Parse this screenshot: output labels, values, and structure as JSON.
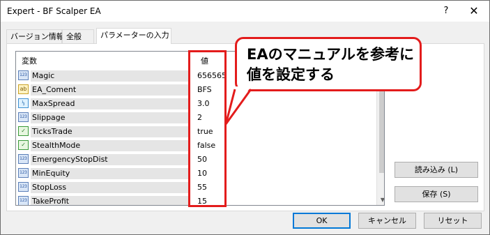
{
  "window": {
    "title": "Expert - BF Scalper EA",
    "help_glyph": "?",
    "close_glyph": "✕"
  },
  "tabs": [
    {
      "label": "バージョン情報"
    },
    {
      "label": "全般"
    },
    {
      "label": "パラメーターの入力",
      "active": true
    }
  ],
  "table": {
    "columns": {
      "variable": "変数",
      "value": "値"
    },
    "rows": [
      {
        "icon": "123",
        "icon_type": "int-icon",
        "name": "Magic",
        "value": "656565"
      },
      {
        "icon": "ab",
        "icon_type": "string-icon",
        "name": "EA_Coment",
        "value": "BFS"
      },
      {
        "icon": "½",
        "icon_type": "double-icon",
        "name": "MaxSpread",
        "value": "3.0"
      },
      {
        "icon": "123",
        "icon_type": "int-icon",
        "name": "Slippage",
        "value": "2"
      },
      {
        "icon": "✓",
        "icon_type": "bool-icon",
        "name": "TicksTrade",
        "value": "true"
      },
      {
        "icon": "✓",
        "icon_type": "bool-icon",
        "name": "StealthMode",
        "value": "false"
      },
      {
        "icon": "123",
        "icon_type": "int-icon",
        "name": "EmergencyStopDist",
        "value": "50"
      },
      {
        "icon": "123",
        "icon_type": "int-icon",
        "name": "MinEquity",
        "value": "10"
      },
      {
        "icon": "123",
        "icon_type": "int-icon",
        "name": "StopLoss",
        "value": "55"
      },
      {
        "icon": "123",
        "icon_type": "int-icon",
        "name": "TakeProfit",
        "value": "15"
      }
    ]
  },
  "callout": {
    "line1": "EAのマニュアルを参考に",
    "line2": "値を設定する",
    "color": "#e31c1c"
  },
  "side_buttons": {
    "load": "読み込み (L)",
    "save": "保存 (S)"
  },
  "footer_buttons": {
    "ok": "OK",
    "cancel": "キャンセル",
    "reset": "リセット"
  }
}
